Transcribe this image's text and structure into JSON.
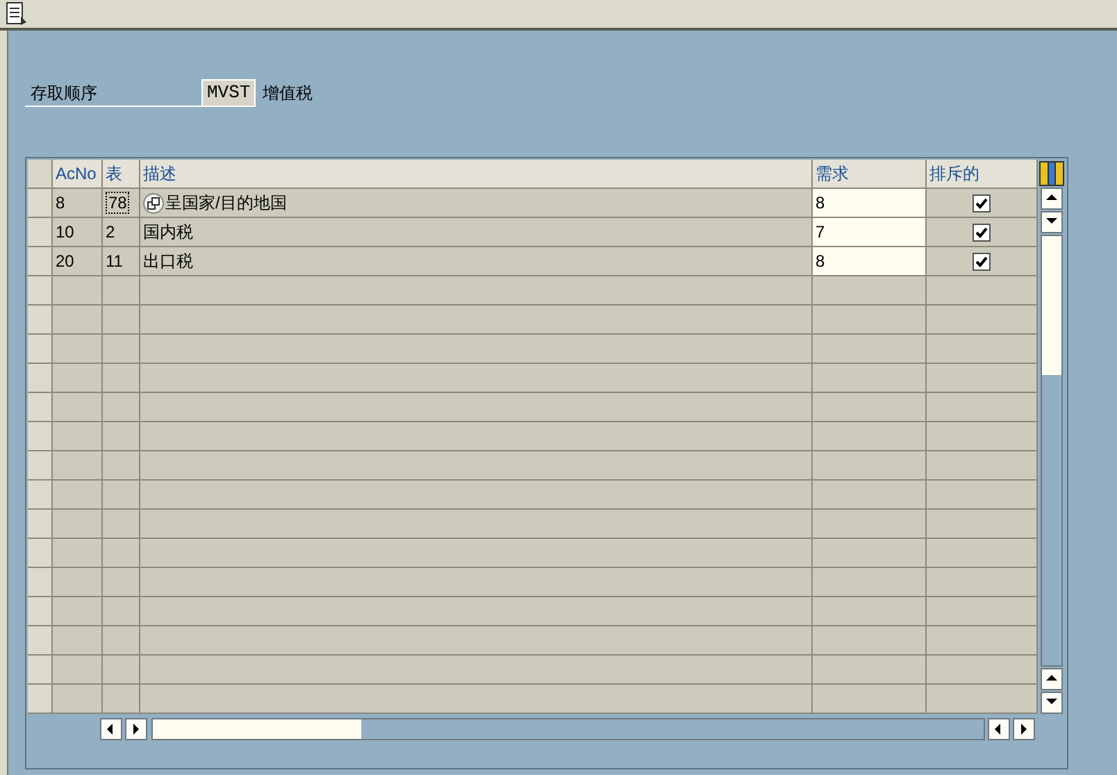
{
  "field": {
    "label": "存取顺序",
    "value": "MVST",
    "description": "增值税"
  },
  "table": {
    "columns": [
      "AcNo",
      "表",
      "描述",
      "需求",
      "排斥的"
    ],
    "rows": [
      {
        "acno": "8",
        "table": "78",
        "table_focused": true,
        "icon": true,
        "description": "呈国家/目的地国",
        "requirement": "8",
        "exclusive": true
      },
      {
        "acno": "10",
        "table": "2",
        "table_focused": false,
        "icon": false,
        "description": "国内税",
        "requirement": "7",
        "exclusive": true
      },
      {
        "acno": "20",
        "table": "11",
        "table_focused": false,
        "icon": false,
        "description": "出口税",
        "requirement": "8",
        "exclusive": true
      }
    ]
  }
}
